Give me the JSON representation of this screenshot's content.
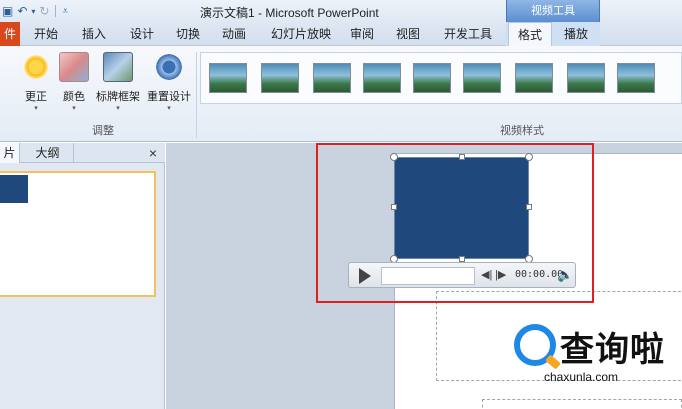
{
  "titlebar": {
    "title": "演示文稿1 - Microsoft PowerPoint",
    "context_group": "视频工具"
  },
  "tabs": {
    "file_fragment": "件",
    "items": [
      "开始",
      "插入",
      "设计",
      "切换",
      "动画",
      "幻灯片放映",
      "审阅",
      "视图",
      "开发工具",
      "格式",
      "播放"
    ],
    "active": "格式"
  },
  "ribbon": {
    "buttons": [
      {
        "label": "更正",
        "icon": "sun-correction-icon"
      },
      {
        "label": "颜色",
        "icon": "color-icon"
      },
      {
        "label": "标牌框架",
        "icon": "poster-frame-icon"
      },
      {
        "label": "重置设计",
        "icon": "reset-design-icon"
      }
    ],
    "group_adjust": "调整",
    "group_styles": "视频样式",
    "style_count": 9
  },
  "left_panel": {
    "tab_slides": "片",
    "tab_outline": "大纲",
    "close": "×"
  },
  "player": {
    "time": "00:00.00"
  },
  "watermark": {
    "text": "查询啦",
    "url": "chaxunla.com"
  },
  "colors": {
    "video_fill": "#1f497d",
    "highlight_border": "#e02020",
    "file_tab": "#d9471d",
    "context_tab": "#5b8fd0"
  }
}
